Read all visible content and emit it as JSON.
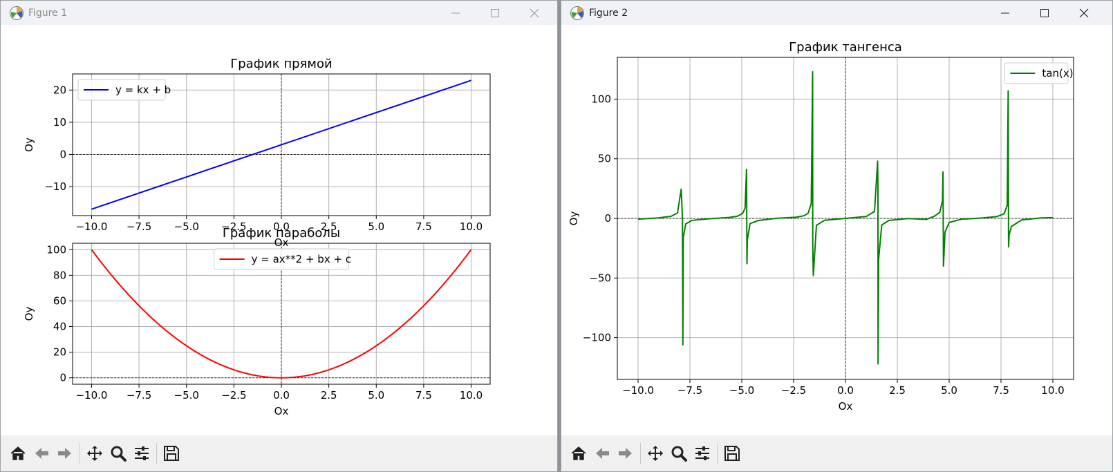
{
  "windows": {
    "figure1": {
      "title": "Figure 1"
    },
    "figure2": {
      "title": "Figure 2"
    }
  },
  "toolbar": {
    "buttons": [
      "home-icon",
      "back-arrow-icon",
      "forward-arrow-icon",
      "pan-icon",
      "zoom-icon",
      "configure-subplots-icon",
      "save-icon"
    ]
  },
  "colors": {
    "line": "#0000ff",
    "parabola": "#ff0000",
    "tangent": "#008000",
    "grid": "#b0b0b0"
  },
  "chart_data": [
    {
      "type": "line",
      "title": "График прямой",
      "xlabel": "Ox",
      "ylabel": "Oy",
      "xlim": [
        -11,
        11
      ],
      "ylim": [
        -19,
        25
      ],
      "xticks": [
        -10.0,
        -7.5,
        -5.0,
        -2.5,
        0.0,
        2.5,
        5.0,
        7.5,
        10.0
      ],
      "xtick_labels": [
        "−10.0",
        "−7.5",
        "−5.0",
        "−2.5",
        "0.0",
        "2.5",
        "5.0",
        "7.5",
        "10.0"
      ],
      "yticks": [
        -10,
        0,
        10,
        20
      ],
      "ytick_labels": [
        "−10",
        "0",
        "10",
        "20"
      ],
      "grid": true,
      "legend": "upper-left",
      "series": [
        {
          "name": "y = kx + b",
          "color": "#0000ff",
          "x": [
            -10,
            10
          ],
          "y": [
            -17,
            23
          ]
        }
      ]
    },
    {
      "type": "line",
      "title": "График параболы",
      "xlabel": "Ox",
      "ylabel": "Oy",
      "xlim": [
        -11,
        11
      ],
      "ylim": [
        -5,
        105
      ],
      "xticks": [
        -10.0,
        -7.5,
        -5.0,
        -2.5,
        0.0,
        2.5,
        5.0,
        7.5,
        10.0
      ],
      "xtick_labels": [
        "−10.0",
        "−7.5",
        "−5.0",
        "−2.5",
        "0.0",
        "2.5",
        "5.0",
        "7.5",
        "10.0"
      ],
      "yticks": [
        0,
        20,
        40,
        60,
        80,
        100
      ],
      "ytick_labels": [
        "0",
        "20",
        "40",
        "60",
        "80",
        "100"
      ],
      "grid": true,
      "legend": "upper-center",
      "series": [
        {
          "name": "y = ax**2 + bx + c",
          "color": "#ff0000",
          "x": [
            -10,
            -7.5,
            -5,
            -2.5,
            0,
            2.5,
            5,
            7.5,
            10
          ],
          "y": [
            100,
            56.25,
            25,
            6.25,
            0,
            6.25,
            25,
            56.25,
            100
          ]
        }
      ]
    },
    {
      "type": "line",
      "title": "График тангенса",
      "xlabel": "Ox",
      "ylabel": "Oy",
      "xlim": [
        -11,
        11
      ],
      "ylim": [
        -135,
        135
      ],
      "xticks": [
        -10.0,
        -7.5,
        -5.0,
        -2.5,
        0.0,
        2.5,
        5.0,
        7.5,
        10.0
      ],
      "xtick_labels": [
        "−10.0",
        "−7.5",
        "−5.0",
        "−2.5",
        "0.0",
        "2.5",
        "5.0",
        "7.5",
        "10.0"
      ],
      "yticks": [
        -100,
        -50,
        0,
        50,
        100
      ],
      "ytick_labels": [
        "−100",
        "−50",
        "0",
        "50",
        "100"
      ],
      "grid": true,
      "legend": "upper-right",
      "series": [
        {
          "name": "tan(x)",
          "color": "#008000",
          "x": [
            -10,
            -9,
            -8.4,
            -8.1,
            -7.92,
            -7.86,
            -7.84,
            -7.82,
            -7.7,
            -7.4,
            -6.5,
            -5.6,
            -5.2,
            -4.96,
            -4.84,
            -4.77,
            -4.75,
            -4.73,
            -4.6,
            -4.2,
            -3.3,
            -2.4,
            -2.0,
            -1.8,
            -1.65,
            -1.583,
            -1.577,
            -1.55,
            -1.4,
            -1.0,
            0,
            1.0,
            1.4,
            1.55,
            1.567,
            1.572,
            1.6,
            1.75,
            2.1,
            3.0,
            3.9,
            4.3,
            4.55,
            4.68,
            4.702,
            4.725,
            4.8,
            5.0,
            5.6,
            6.5,
            7.3,
            7.65,
            7.8,
            7.846,
            7.864,
            7.89,
            8.0,
            8.5,
            9.4,
            10
          ],
          "y": [
            -0.65,
            0.45,
            1.8,
            4.5,
            24.5,
            0,
            -106,
            -16,
            -4.6,
            -1.7,
            -0.22,
            0.8,
            1.9,
            4.1,
            8.5,
            41,
            -38,
            -18,
            -4.4,
            -1.8,
            0.16,
            0.92,
            2.2,
            4.3,
            12.5,
            123,
            -23,
            -48,
            -5.8,
            -1.56,
            0,
            1.56,
            5.8,
            48,
            24,
            -122,
            -34,
            -5.5,
            -1.71,
            -0.14,
            -0.9,
            1.9,
            5.2,
            15,
            39,
            -40,
            -11.5,
            -3.4,
            -0.68,
            0.22,
            1.5,
            3.9,
            11,
            107,
            -24,
            -14,
            -6.8,
            -1.3,
            0.33,
            0.65
          ]
        }
      ]
    }
  ]
}
